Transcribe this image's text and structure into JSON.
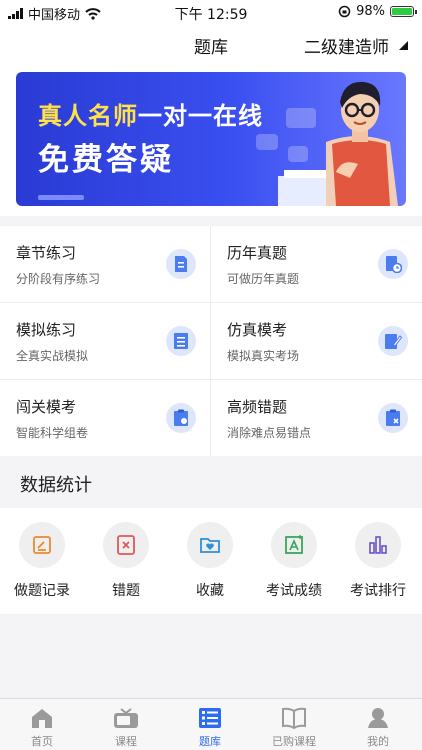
{
  "status_bar": {
    "carrier": "中国移动",
    "time": "下午 12:59",
    "battery": "98%"
  },
  "nav": {
    "title": "题库",
    "selector": "二级建造师"
  },
  "banner": {
    "line1_highlight": "真人名师",
    "line1_rest": "一对一在线",
    "line2": "免费答疑"
  },
  "practice": [
    {
      "name": "章节练习",
      "desc": "分阶段有序练习",
      "icon": "document-icon"
    },
    {
      "name": "历年真题",
      "desc": "可做历年真题",
      "icon": "clock-document-icon"
    },
    {
      "name": "模拟练习",
      "desc": "全真实战模拟",
      "icon": "list-icon"
    },
    {
      "name": "仿真模考",
      "desc": "模拟真实考场",
      "icon": "edit-icon"
    },
    {
      "name": "闯关模考",
      "desc": "智能科学组卷",
      "icon": "clipboard-icon"
    },
    {
      "name": "高频错题",
      "desc": "消除难点易错点",
      "icon": "clipboard-x-icon"
    }
  ],
  "stats": {
    "title": "数据统计",
    "items": [
      {
        "label": "做题记录",
        "icon": "record-icon",
        "color": "#e9892d"
      },
      {
        "label": "错题",
        "icon": "wrong-icon",
        "color": "#e0575a"
      },
      {
        "label": "收藏",
        "icon": "favorite-folder-icon",
        "color": "#2f8fd6"
      },
      {
        "label": "考试成绩",
        "icon": "score-icon",
        "color": "#3aa65a"
      },
      {
        "label": "考试排行",
        "icon": "ranking-icon",
        "color": "#6a52c9"
      }
    ]
  },
  "tabs": [
    {
      "label": "首页",
      "icon": "home-icon"
    },
    {
      "label": "课程",
      "icon": "tv-icon"
    },
    {
      "label": "题库",
      "icon": "question-bank-icon"
    },
    {
      "label": "已购课程",
      "icon": "book-icon"
    },
    {
      "label": "我的",
      "icon": "user-icon"
    }
  ],
  "colors": {
    "accent": "#2d6cf0",
    "banner": "#2a3bd4",
    "highlight": "#ffe14d"
  }
}
